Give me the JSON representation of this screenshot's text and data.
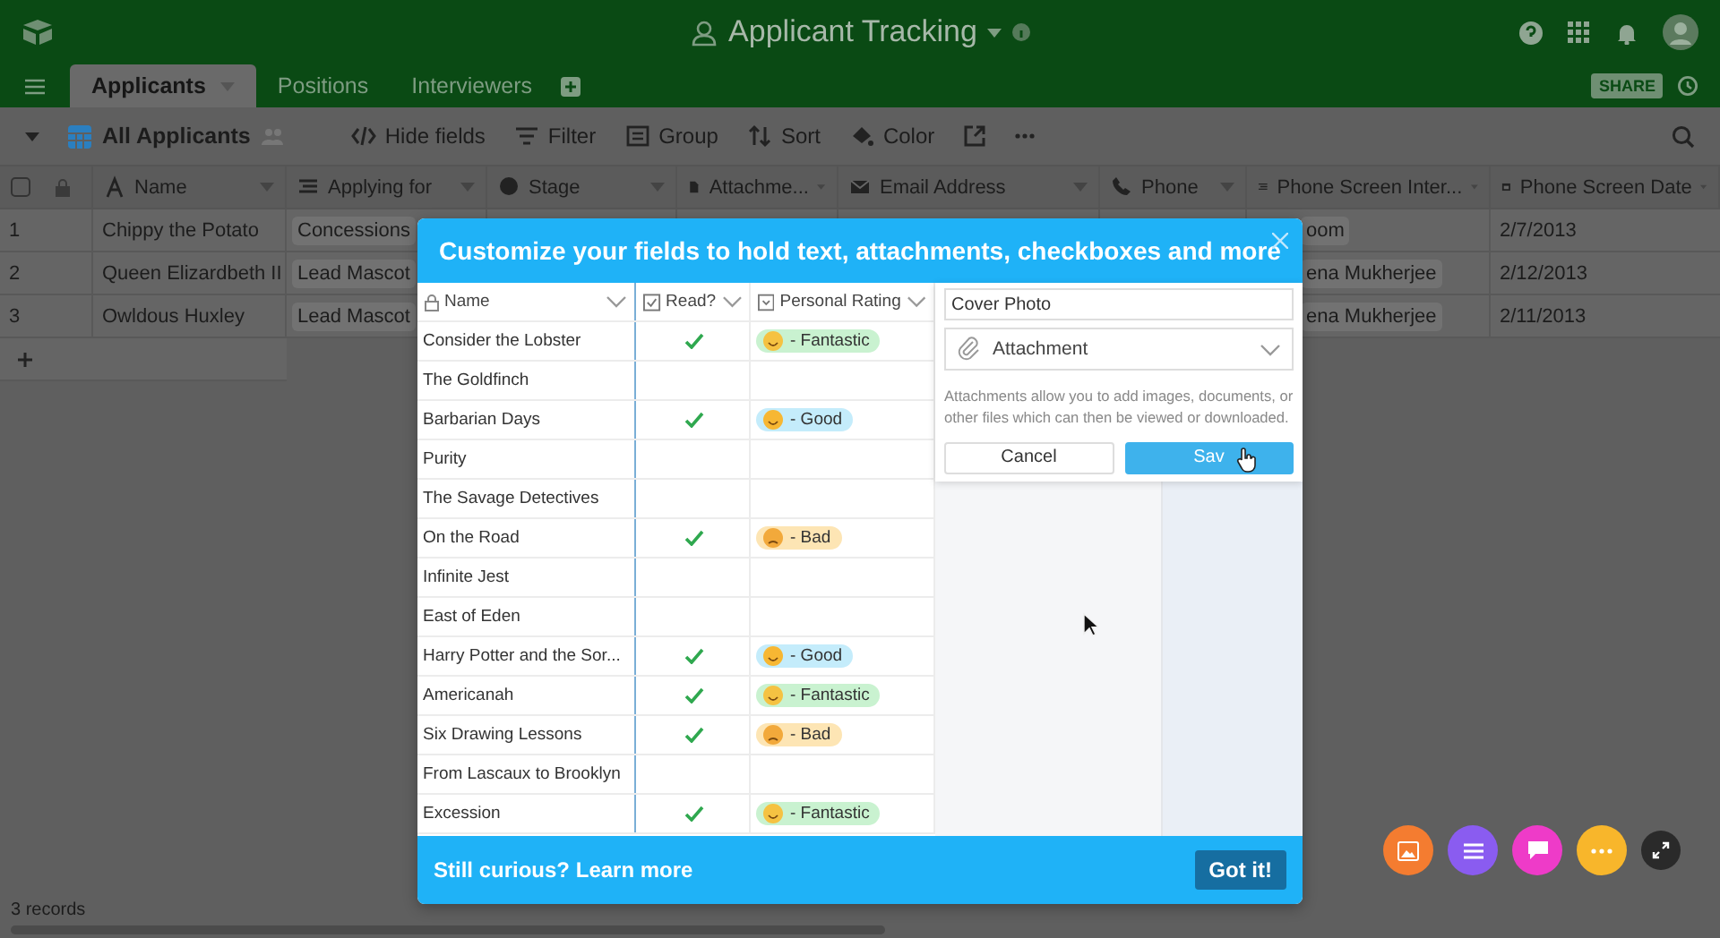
{
  "header": {
    "title": "Applicant Tracking"
  },
  "tabs": [
    {
      "label": "Applicants",
      "selected": true
    },
    {
      "label": "Positions",
      "selected": false
    },
    {
      "label": "Interviewers",
      "selected": false
    }
  ],
  "share": "SHARE",
  "toolbar": {
    "view": "All Applicants",
    "actions": [
      "Hide fields",
      "Filter",
      "Group",
      "Sort",
      "Color"
    ]
  },
  "table": {
    "columns": [
      "Name",
      "Applying for",
      "Stage",
      "Attachme...",
      "Email Address",
      "Phone",
      "Phone Screen Inter...",
      "Phone Screen Date"
    ],
    "select_all": {
      "checked": false
    },
    "rows": [
      {
        "number": "1",
        "name": "Chippy the Potato",
        "applying_for": "Concessions",
        "interviewer": "oom",
        "date": "2/7/2013"
      },
      {
        "number": "2",
        "name": "Queen Elizardbeth II",
        "applying_for": "Lead Mascot",
        "interviewer": "ena Mukherjee",
        "date": "2/12/2013"
      },
      {
        "number": "3",
        "name": "Owldous Huxley",
        "applying_for": "Lead Mascot",
        "interviewer": "ena Mukherjee",
        "date": "2/11/2013"
      }
    ]
  },
  "footer": {
    "records": "3 records"
  },
  "modal": {
    "title": "Customize your fields to hold text, attachments, checkboxes and more",
    "columns": [
      "Name",
      "Read?",
      "Personal Rating"
    ],
    "rows": [
      {
        "name": "Consider the Lobster",
        "read": true,
        "rating": {
          "label": "- Fantastic",
          "kind": "fantastic"
        }
      },
      {
        "name": "The Goldfinch",
        "read": false
      },
      {
        "name": "Barbarian Days",
        "read": true,
        "rating": {
          "label": "- Good",
          "kind": "good"
        }
      },
      {
        "name": "Purity",
        "read": false
      },
      {
        "name": "The Savage Detectives",
        "read": false
      },
      {
        "name": "On the Road",
        "read": true,
        "rating": {
          "label": "- Bad",
          "kind": "bad"
        }
      },
      {
        "name": "Infinite Jest",
        "read": false
      },
      {
        "name": "East of Eden",
        "read": false
      },
      {
        "name": "Harry Potter and the Sor...",
        "read": true,
        "rating": {
          "label": "- Good",
          "kind": "good"
        }
      },
      {
        "name": "Americanah",
        "read": true,
        "rating": {
          "label": "- Fantastic",
          "kind": "fantastic"
        }
      },
      {
        "name": "Six Drawing Lessons",
        "read": true,
        "rating": {
          "label": "- Bad",
          "kind": "bad"
        }
      },
      {
        "name": "From Lascaux to Brooklyn",
        "read": false
      },
      {
        "name": "Excession",
        "read": true,
        "rating": {
          "label": "- Fantastic",
          "kind": "fantastic"
        }
      }
    ],
    "field_editor": {
      "field_name": "Cover Photo",
      "field_type": "Attachment",
      "help": "Attachments allow you to add images, documents, or other files which can then be viewed or downloaded.",
      "cancel": "Cancel",
      "save": "Sav"
    },
    "footer_text": "Still curious?",
    "link": "Learn more",
    "button": "Got it!"
  }
}
